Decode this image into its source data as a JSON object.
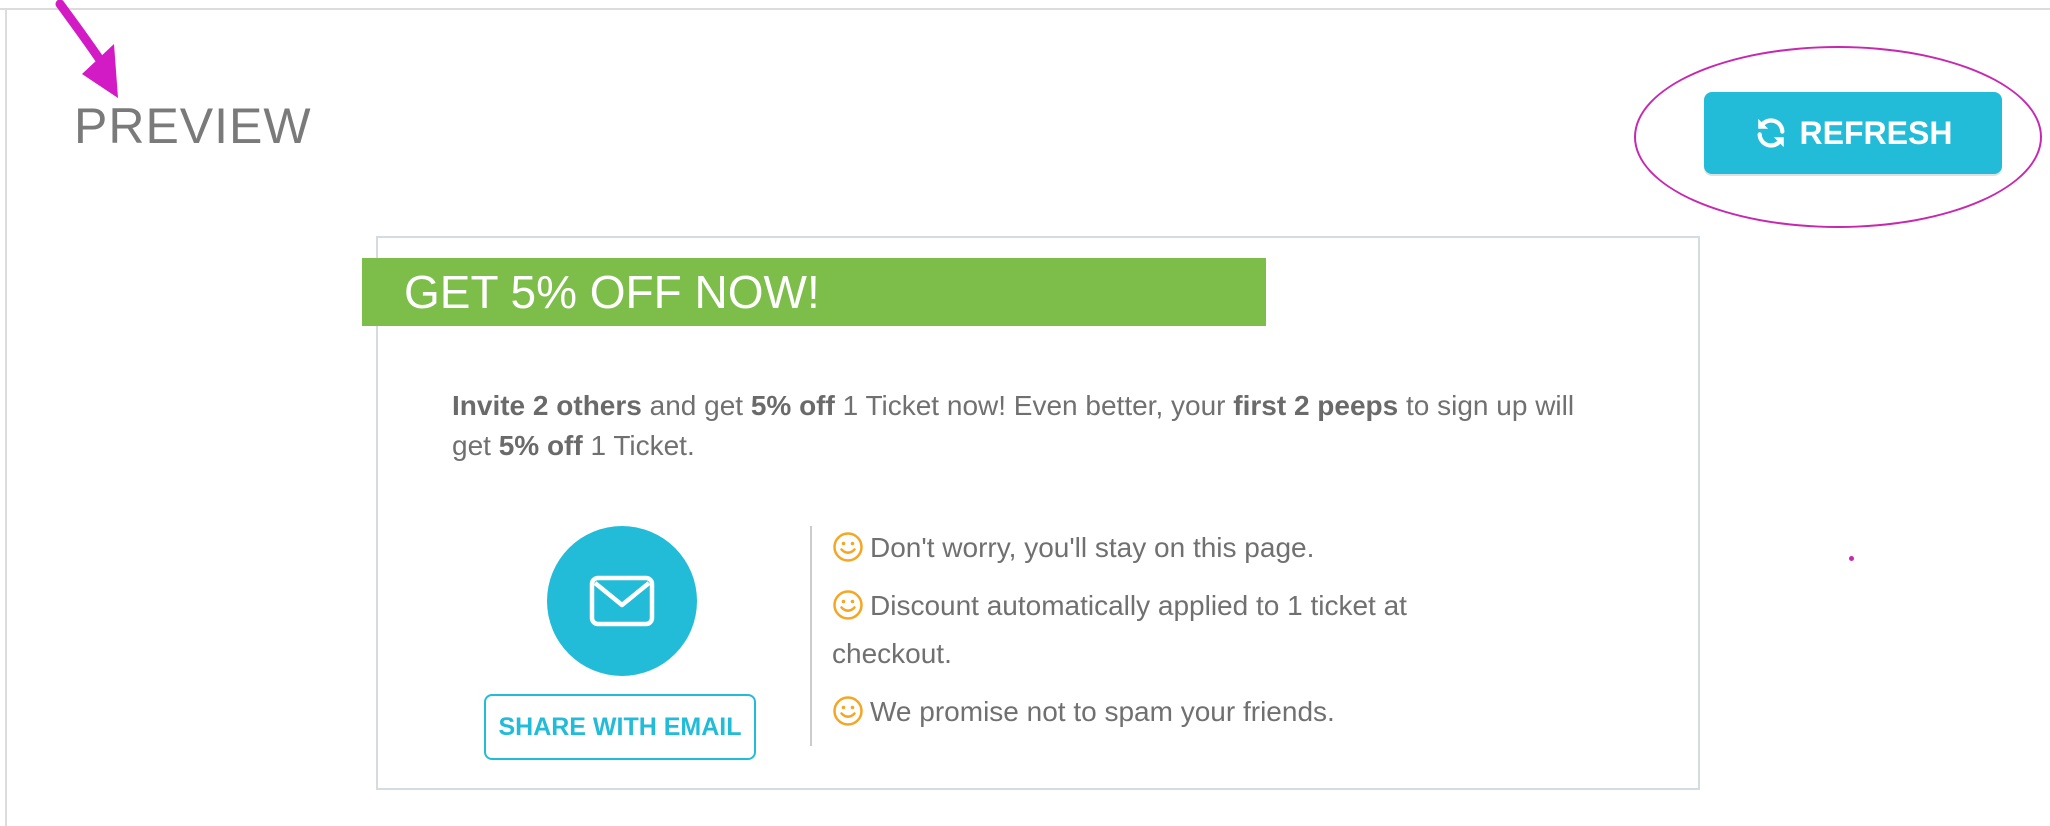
{
  "header": {
    "title": "PREVIEW",
    "refresh_label": "REFRESH"
  },
  "widget": {
    "banner": "GET 5% OFF NOW!",
    "invite": {
      "p1": "Invite 2 others",
      "p2": " and get ",
      "p3": "5% off",
      "p4": " 1 Ticket now! Even better, your ",
      "p5": "first 2 peeps",
      "p6": " to sign up will get ",
      "p7": "5% off",
      "p8": " 1 Ticket."
    },
    "share_email_label": "SHARE WITH EMAIL",
    "benefits": [
      "Don't worry, you'll stay on this page.",
      "Discount automatically applied to 1 ticket at checkout.",
      "We promise not to spam your friends."
    ]
  },
  "colors": {
    "accent": "#22bcd9",
    "banner": "#7dbd49",
    "smiley": "#f5a623",
    "annotation": "#c728b0",
    "text": "#707070"
  },
  "icons": [
    "refresh-icon",
    "envelope-icon",
    "smiley-icon",
    "annotation-arrow-icon"
  ]
}
